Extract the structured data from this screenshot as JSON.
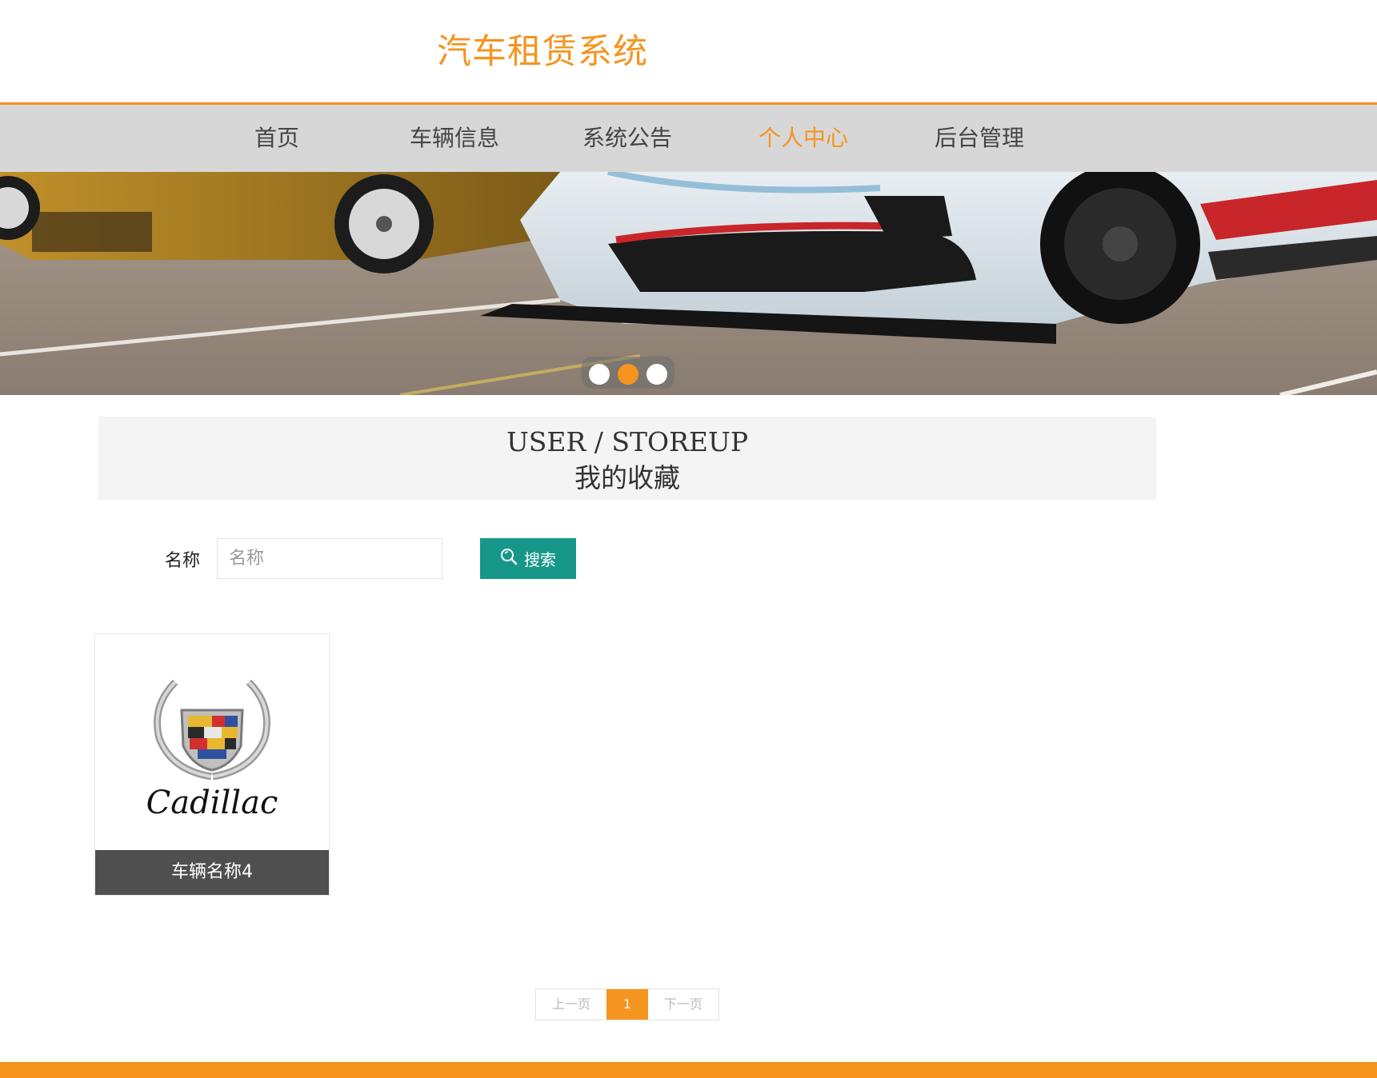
{
  "header": {
    "title": "汽车租赁系统"
  },
  "nav": {
    "items": [
      {
        "label": "首页",
        "active": false
      },
      {
        "label": "车辆信息",
        "active": false
      },
      {
        "label": "系统公告",
        "active": false
      },
      {
        "label": "个人中心",
        "active": true
      },
      {
        "label": "后台管理",
        "active": false
      }
    ]
  },
  "carousel": {
    "slide_count": 3,
    "active_index": 1
  },
  "section": {
    "title_en": "USER / STOREUP",
    "title_cn": "我的收藏"
  },
  "search": {
    "label": "名称",
    "placeholder": "名称",
    "value": "",
    "button_label": "搜索",
    "button_icon": "search-icon"
  },
  "items": [
    {
      "name": "车辆名称4",
      "logo_text": "Cadillac"
    }
  ],
  "pagination": {
    "prev_label": "上一页",
    "current": "1",
    "next_label": "下一页"
  },
  "colors": {
    "accent": "#f5941f",
    "nav_bg": "#d7d7d7",
    "button": "#16978a",
    "caption_bg": "#4f4f4f"
  }
}
